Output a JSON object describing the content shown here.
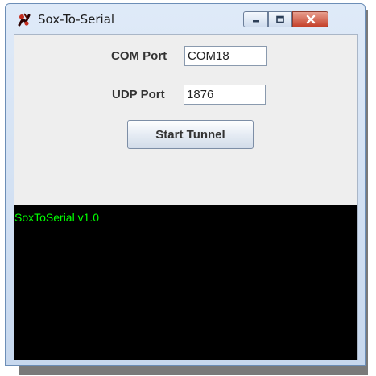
{
  "window": {
    "title": "Sox-To-Serial"
  },
  "icons": {
    "app": "app-icon",
    "minimize": "minimize-icon",
    "maximize": "maximize-icon",
    "close": "close-icon"
  },
  "form": {
    "com_port_label": "COM Port",
    "com_port_value": "COM18",
    "udp_port_label": "UDP Port",
    "udp_port_value": "1876",
    "start_button_label": "Start Tunnel"
  },
  "console": {
    "lines": [
      "SoxToSerial v1.0"
    ]
  },
  "colors": {
    "console_bg": "#000000",
    "console_text": "#00ff00",
    "window_bg": "#eeeeee"
  }
}
